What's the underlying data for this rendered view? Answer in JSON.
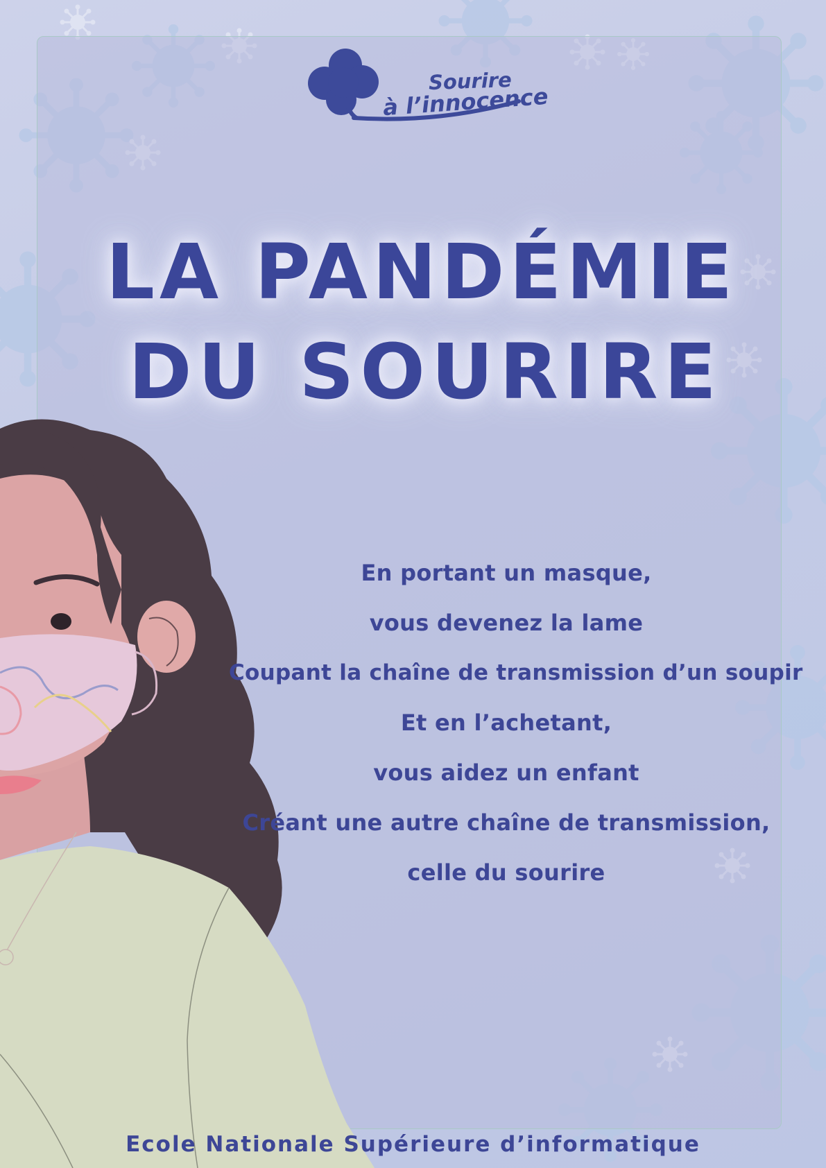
{
  "logo": {
    "line1": "Sourire",
    "line2": "à l’innocence"
  },
  "title": {
    "line1": "LA PANDÉMIE",
    "line2": "DU SOURIRE"
  },
  "poem": [
    "En portant un masque,",
    "vous devenez la lame",
    "Coupant la chaîne de transmission d’un soupir",
    "Et en l’achetant,",
    "vous aidez un enfant",
    "Créant une autre chaîne de transmission,",
    "celle du sourire"
  ],
  "footer": "Ecole Nationale Supérieure d’informatique",
  "colors": {
    "text": "#3b4699",
    "frame_border": "#a9c9c6",
    "background": "#c4cbe6"
  },
  "icons": {
    "logo": "clover-icon",
    "decor": "virus-icon"
  }
}
